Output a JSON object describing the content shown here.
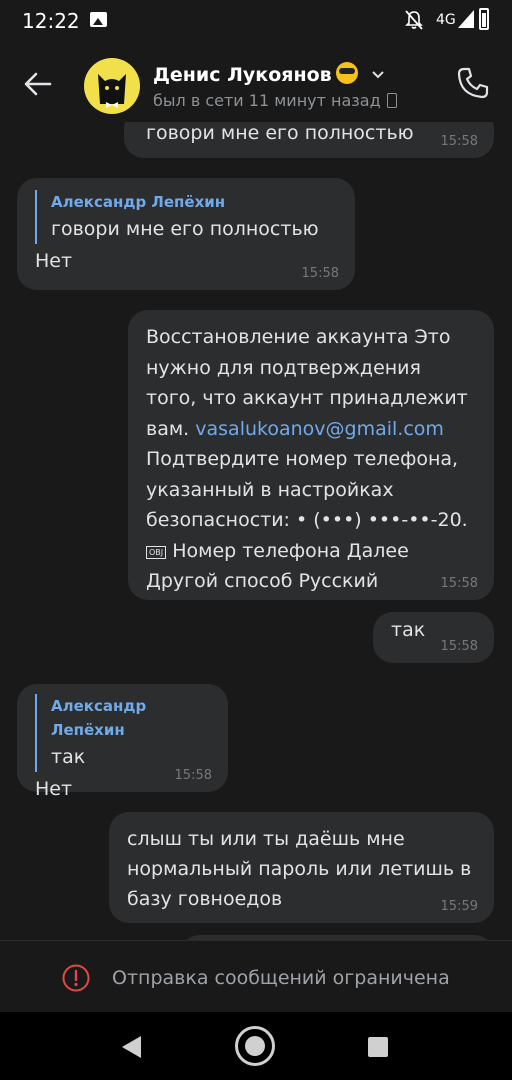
{
  "status_bar": {
    "time": "12:22",
    "network": "4G"
  },
  "header": {
    "contact_name": "Денис Лукоянов",
    "last_seen": "был в сети 11 минут назад"
  },
  "messages": [
    {
      "direction": "out",
      "text": "говори мне его полностью",
      "time": "15:58"
    },
    {
      "direction": "in",
      "reply_author": "Александр Лепёхин",
      "reply_text": "говори мне его полностью",
      "text": "Нет",
      "time": "15:58"
    },
    {
      "direction": "out",
      "text_before_link": "Восстановление аккаунта Это нужно для подтверждения того, что аккаунт принадлежит вам.",
      "link": "vasalukoanov@gmail.com",
      "text_after_link": "Подтвердите номер телефона, указанный в настройках безопасности: • (•••) •••-••-20.",
      "obj_marker": "OBJ",
      "text_end": "Номер телефона Далее Другой способ Русский",
      "time": "15:58"
    },
    {
      "direction": "out",
      "text": "так",
      "time": "15:58"
    },
    {
      "direction": "in",
      "reply_author": "Александр Лепёхин",
      "reply_text": "так",
      "text": "Нет",
      "time": "15:58"
    },
    {
      "direction": "out",
      "text": "слыш ты или ты даёшь мне нормальный пароль или летишь в базу говноедов",
      "time": "15:59"
    }
  ],
  "restriction": {
    "text": "Отправка сообщений ограничена"
  },
  "colors": {
    "background": "#19191a",
    "bubble": "#2c2d2e",
    "accent": "#71aaeb",
    "warning": "#e64646"
  }
}
